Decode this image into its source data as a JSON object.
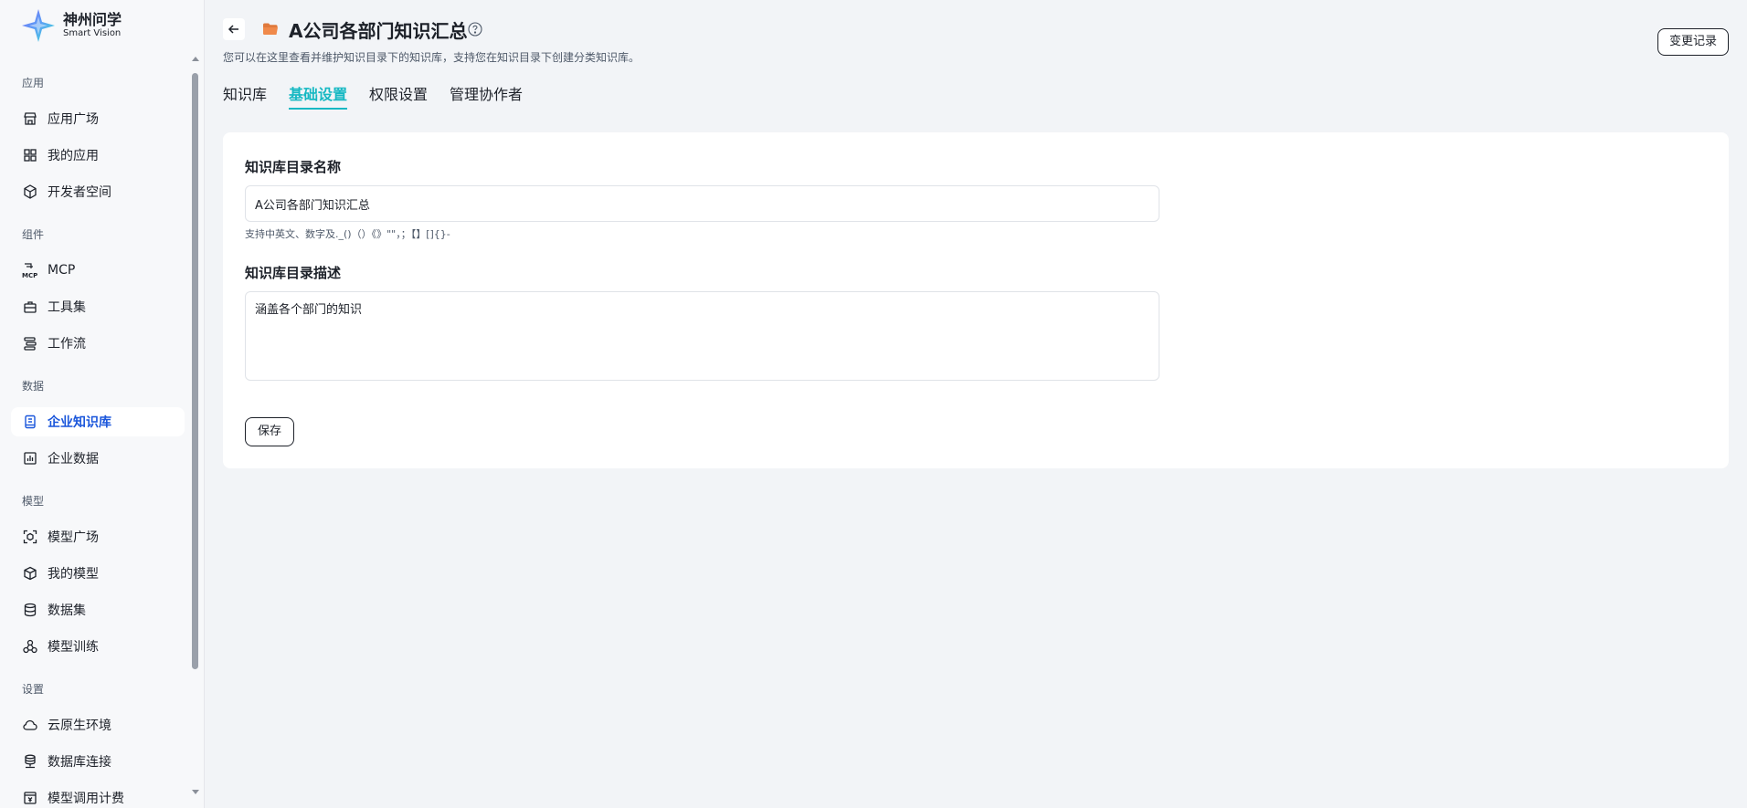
{
  "brand": {
    "name_cn": "神州问学",
    "name_en": "Smart Vision",
    "accent": "#16b8c3",
    "active_nav_color": "#1a56db"
  },
  "sidebar": {
    "groups": [
      {
        "label": "应用",
        "items": [
          {
            "label": "应用广场",
            "icon": "store-icon"
          },
          {
            "label": "我的应用",
            "icon": "grid-icon"
          },
          {
            "label": "开发者空间",
            "icon": "cube-network-icon"
          }
        ]
      },
      {
        "label": "组件",
        "items": [
          {
            "label": "MCP",
            "icon": "mcp-icon"
          },
          {
            "label": "工具集",
            "icon": "toolbox-icon"
          },
          {
            "label": "工作流",
            "icon": "workflow-icon"
          }
        ]
      },
      {
        "label": "数据",
        "items": [
          {
            "label": "企业知识库",
            "icon": "knowledge-book-icon",
            "active": true
          },
          {
            "label": "企业数据",
            "icon": "bar-chart-icon"
          }
        ]
      },
      {
        "label": "模型",
        "items": [
          {
            "label": "模型广场",
            "icon": "model-scan-icon"
          },
          {
            "label": "我的模型",
            "icon": "box-icon"
          },
          {
            "label": "数据集",
            "icon": "database-icon"
          },
          {
            "label": "模型训练",
            "icon": "training-icon"
          }
        ]
      },
      {
        "label": "设置",
        "items": [
          {
            "label": "云原生环境",
            "icon": "cloud-icon"
          },
          {
            "label": "数据库连接",
            "icon": "db-connect-icon"
          },
          {
            "label": "模型调用计费",
            "icon": "billing-icon"
          }
        ]
      }
    ]
  },
  "header": {
    "title": "A公司各部门知识汇总",
    "subtitle": "您可以在这里查看并维护知识目录下的知识库，支持您在知识目录下创建分类知识库。",
    "history_button": "变更记录"
  },
  "tabs": [
    {
      "label": "知识库",
      "active": false
    },
    {
      "label": "基础设置",
      "active": true
    },
    {
      "label": "权限设置",
      "active": false
    },
    {
      "label": "管理协作者",
      "active": false
    }
  ],
  "form": {
    "name_label": "知识库目录名称",
    "name_value": "A公司各部门知识汇总",
    "name_hint": "支持中英文、数字及._()（）《》\"\"，；【】[]{}-",
    "desc_label": "知识库目录描述",
    "desc_value": "涵盖各个部门的知识",
    "save_button": "保存"
  }
}
